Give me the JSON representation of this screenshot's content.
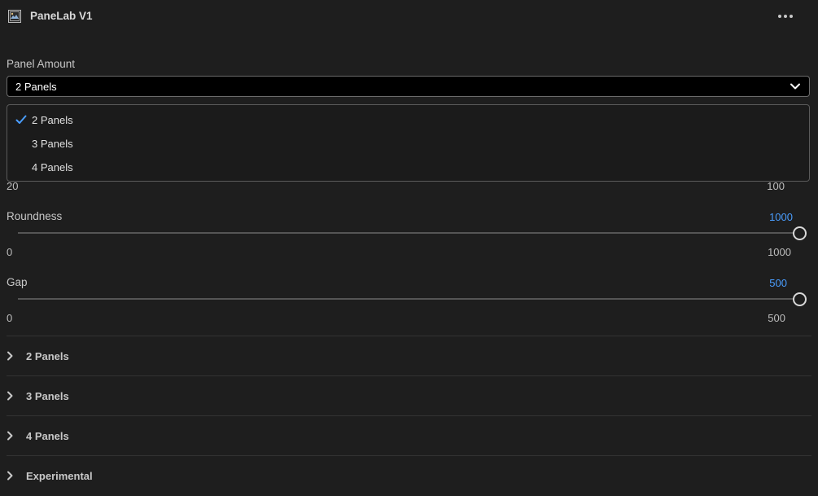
{
  "header": {
    "title": "PaneLab V1",
    "app_icon": "panelab-app-icon",
    "more_icon": "more-horizontal-icon"
  },
  "panel_amount": {
    "label": "Panel Amount",
    "selected": "2 Panels",
    "options": [
      {
        "label": "2 Panels",
        "checked": true
      },
      {
        "label": "3 Panels",
        "checked": false
      },
      {
        "label": "4 Panels",
        "checked": false
      }
    ]
  },
  "hidden_slider": {
    "min": "20",
    "max": "100"
  },
  "roundness": {
    "label": "Roundness",
    "value": "1000",
    "min": "0",
    "max": "1000",
    "fraction": 1.0
  },
  "gap": {
    "label": "Gap",
    "value": "500",
    "min": "0",
    "max": "500",
    "fraction": 1.0
  },
  "sections": [
    {
      "label": "2 Panels"
    },
    {
      "label": "3 Panels"
    },
    {
      "label": "4 Panels"
    },
    {
      "label": "Experimental"
    }
  ],
  "colors": {
    "background": "#1e1e1e",
    "accent": "#4a9eff",
    "select_bg": "#000000"
  }
}
